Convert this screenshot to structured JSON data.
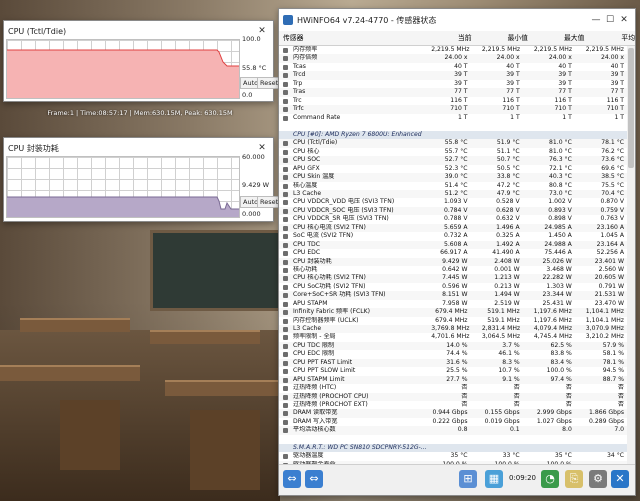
{
  "win1": {
    "title": "CPU (Tctl/Tdie)",
    "max": "100.0",
    "current": "55.8 °C",
    "min": "0.0",
    "btn_auto": "Auto Fit",
    "btn_reset": "Reset",
    "fill_color": "#f6b3b3",
    "line_color": "#e04040"
  },
  "status_text": "Frame:1 | Time:08:57:17 | Mem:630.15M, Peak: 630.15M",
  "win2": {
    "title": "CPU 封装功耗",
    "max": "60.000",
    "current": "9.429 W",
    "min": "0.000",
    "btn_auto": "Auto Fit",
    "btn_reset": "Reset",
    "fill_color": "#b6a8c8"
  },
  "hw": {
    "title": "HWiNFO64 v7.24-4770 - 传感器状态",
    "headers": [
      "传感器",
      "当前",
      "最小值",
      "最大值",
      "平均"
    ],
    "rows1": [
      [
        "内存频率",
        "2,219.5 MHz",
        "2,219.5 MHz",
        "2,219.5 MHz",
        "2,219.5 MHz"
      ],
      [
        "内存倍频",
        "24.00 x",
        "24.00 x",
        "24.00 x",
        "24.00 x"
      ],
      [
        "Tcas",
        "40 T",
        "40 T",
        "40 T",
        "40 T"
      ],
      [
        "Trcd",
        "39 T",
        "39 T",
        "39 T",
        "39 T"
      ],
      [
        "Trp",
        "39 T",
        "39 T",
        "39 T",
        "39 T"
      ],
      [
        "Tras",
        "77 T",
        "77 T",
        "77 T",
        "77 T"
      ],
      [
        "Trc",
        "116 T",
        "116 T",
        "116 T",
        "116 T"
      ],
      [
        "Trfc",
        "710 T",
        "710 T",
        "710 T",
        "710 T"
      ],
      [
        "Command Rate",
        "1 T",
        "1 T",
        "1 T",
        "1 T"
      ]
    ],
    "section_cpu": "CPU [#0]: AMD Ryzen 7 6800U: Enhanced",
    "rows2": [
      [
        "CPU (Tctl/Tdie)",
        "55.8 °C",
        "51.9 °C",
        "81.0 °C",
        "78.1 °C"
      ],
      [
        "CPU 核心",
        "55.7 °C",
        "51.1 °C",
        "81.0 °C",
        "76.2 °C"
      ],
      [
        "CPU SOC",
        "52.7 °C",
        "50.7 °C",
        "76.3 °C",
        "73.6 °C"
      ],
      [
        "APU GFX",
        "52.3 °C",
        "50.5 °C",
        "72.1 °C",
        "69.6 °C"
      ],
      [
        "CPU Skin 温度",
        "39.0 °C",
        "33.8 °C",
        "40.3 °C",
        "38.5 °C"
      ],
      [
        "核心温度",
        "51.4 °C",
        "47.2 °C",
        "80.8 °C",
        "75.5 °C"
      ],
      [
        "L3 Cache",
        "51.2 °C",
        "47.9 °C",
        "73.0 °C",
        "70.4 °C"
      ],
      [
        "CPU VDDCR_VDD 电压 (SVI3 TFN)",
        "1.093 V",
        "0.528 V",
        "1.002 V",
        "0.870 V"
      ],
      [
        "CPU VDDCR_SOC 电压 (SVI3 TFN)",
        "0.784 V",
        "0.628 V",
        "0.893 V",
        "0.759 V"
      ],
      [
        "CPU VDDCR_SR 电压 (SVI3 TFN)",
        "0.788 V",
        "0.632 V",
        "0.898 V",
        "0.763 V"
      ],
      [
        "CPU 核心电流 (SVI2 TFN)",
        "5.659 A",
        "1.496 A",
        "24.985 A",
        "23.160 A"
      ],
      [
        "SoC 电流 (SVI2 TFN)",
        "0.732 A",
        "0.325 A",
        "1.450 A",
        "1.045 A"
      ],
      [
        "CPU TDC",
        "5.608 A",
        "1.492 A",
        "24.988 A",
        "23.164 A"
      ],
      [
        "CPU EDC",
        "66.917 A",
        "41.490 A",
        "75.446 A",
        "52.256 A"
      ],
      [
        "CPU 封装功耗",
        "9.429 W",
        "2.408 W",
        "25.026 W",
        "23.401 W"
      ],
      [
        "核心功耗",
        "0.642 W",
        "0.001 W",
        "3.468 W",
        "2.560 W"
      ],
      [
        "CPU 核心功耗 (SVI2 TFN)",
        "7.445 W",
        "1.213 W",
        "22.282 W",
        "20.605 W"
      ],
      [
        "CPU SoC功耗 (SVI2 TFN)",
        "0.596 W",
        "0.213 W",
        "1.303 W",
        "0.791 W"
      ],
      [
        "Core+SoC+SR 功耗 (SVI3 TFN)",
        "8.151 W",
        "1.494 W",
        "23.344 W",
        "21.531 W"
      ],
      [
        "APU STAPM",
        "7.958 W",
        "2.519 W",
        "25.431 W",
        "23.470 W"
      ],
      [
        "Infinity Fabric 频率 (FCLK)",
        "679.4 MHz",
        "519.1 MHz",
        "1,197.6 MHz",
        "1,104.1 MHz"
      ],
      [
        "内存控制器频率 (UCLK)",
        "679.4 MHz",
        "519.1 MHz",
        "1,197.6 MHz",
        "1,104.1 MHz"
      ],
      [
        "L3 Cache",
        "3,769.8 MHz",
        "2,831.4 MHz",
        "4,079.4 MHz",
        "3,070.9 MHz"
      ],
      [
        "频率限制 - 全局",
        "4,701.6 MHz",
        "3,064.5 MHz",
        "4,745.4 MHz",
        "3,210.2 MHz"
      ],
      [
        "CPU TDC 限制",
        "14.0 %",
        "3.7 %",
        "62.5 %",
        "57.9 %"
      ],
      [
        "CPU EDC 限制",
        "74.4 %",
        "46.1 %",
        "83.8 %",
        "58.1 %"
      ],
      [
        "CPU PPT FAST Limit",
        "31.6 %",
        "8.3 %",
        "83.4 %",
        "78.1 %"
      ],
      [
        "CPU PPT SLOW Limit",
        "25.5 %",
        "10.7 %",
        "100.0 %",
        "94.5 %"
      ],
      [
        "APU STAPM Limit",
        "27.7 %",
        "9.1 %",
        "97.4 %",
        "88.7 %"
      ],
      [
        "过热降频 (HTC)",
        "否",
        "否",
        "否",
        "否"
      ],
      [
        "过热降频 (PROCHOT CPU)",
        "否",
        "否",
        "否",
        "否"
      ],
      [
        "过热降频 (PROCHOT EXT)",
        "否",
        "否",
        "否",
        "否"
      ],
      [
        "DRAM 读取带宽",
        "0.944 Gbps",
        "0.155 Gbps",
        "2.999 Gbps",
        "1.866 Gbps"
      ],
      [
        "DRAM 写入带宽",
        "0.222 Gbps",
        "0.019 Gbps",
        "1.027 Gbps",
        "0.289 Gbps"
      ],
      [
        "平均活动核心数",
        "0.8",
        "0.1",
        "8.0",
        "7.0"
      ]
    ],
    "section_smart": "S.M.A.R.T.: WD PC SN810 SDCPNRY-512G-...",
    "rows3": [
      [
        "驱动器温度",
        "35 °C",
        "33 °C",
        "35 °C",
        "34 °C"
      ],
      [
        "驱动器剩余寿命",
        "100.0 %",
        "100.0 %",
        "100.0 %",
        ""
      ],
      [
        "驱动器故障",
        "否",
        "否",
        "否",
        ""
      ]
    ],
    "timer": "0:09:20"
  }
}
